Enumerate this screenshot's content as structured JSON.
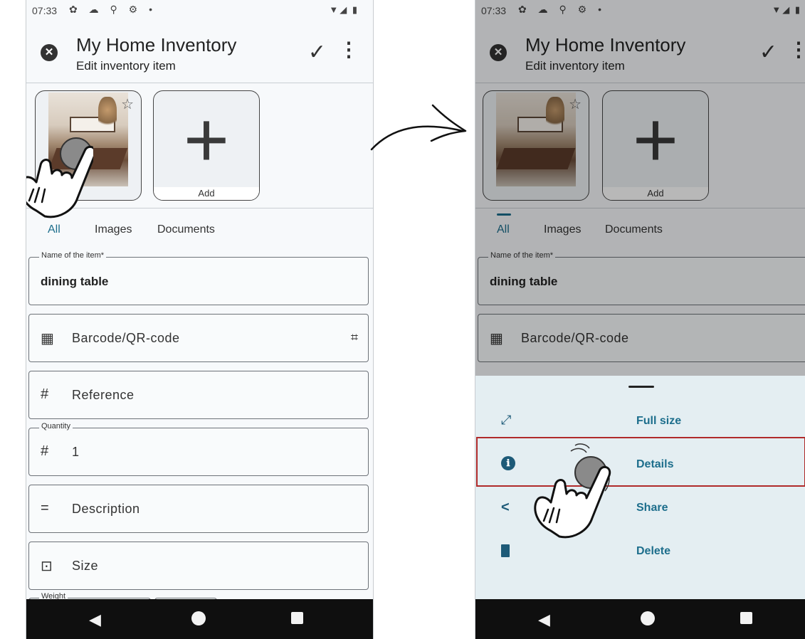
{
  "status_bar": {
    "time": "07:33",
    "left_icons": "✿ ☁ ⚲ ⚙ •",
    "right_icons": "▼◢ ▮"
  },
  "app_bar": {
    "title": "My Home Inventory",
    "subtitle": "Edit inventory item",
    "close_icon": "close-circle-icon",
    "save_icon": "check-icon",
    "menu_icon": "more-vert-icon"
  },
  "gallery": {
    "add_label": "Add",
    "add_glyph": "+",
    "favorite_glyph": "☆"
  },
  "tabs": {
    "all": "All",
    "images": "Images",
    "documents": "Documents",
    "active": "All"
  },
  "fields": {
    "name": {
      "label": "Name of the item*",
      "value": "dining table"
    },
    "barcode": {
      "placeholder": "Barcode/QR-code",
      "icon": "▦",
      "scan_icon": "⌗"
    },
    "reference": {
      "placeholder": "Reference",
      "icon": "#"
    },
    "quantity": {
      "label": "Quantity",
      "value": "1",
      "icon": "#"
    },
    "description": {
      "placeholder": "Description",
      "icon": "="
    },
    "size": {
      "placeholder": "Size",
      "icon": "⊡"
    },
    "weight": {
      "label": "Weight"
    }
  },
  "context_menu": {
    "items": [
      {
        "label": "Full size",
        "icon": "fullscreen-icon",
        "glyph": "⤢"
      },
      {
        "label": "Details",
        "icon": "info-icon",
        "glyph": "ℹ"
      },
      {
        "label": "Share",
        "icon": "share-icon",
        "glyph": "<"
      },
      {
        "label": "Delete",
        "icon": "trash-icon",
        "glyph": "🗑"
      }
    ],
    "highlighted": "Details"
  },
  "nav_bar": {
    "back_glyph": "◀"
  },
  "colors": {
    "accent": "#1d6e8c",
    "highlight_border": "#b02a2a",
    "sheet_bg": "#e4eef2",
    "nav_bg": "#0f0f0f"
  }
}
